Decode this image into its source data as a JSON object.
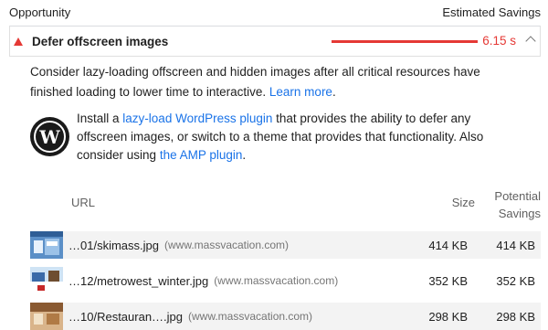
{
  "header": {
    "left": "Opportunity",
    "right": "Estimated Savings"
  },
  "audit": {
    "title": "Defer offscreen images",
    "value": "6.15 s",
    "status_color": "#e53935"
  },
  "description": {
    "text": "Consider lazy-loading offscreen and hidden images after all critical resources have finished loading to lower time to interactive.",
    "link": "Learn more"
  },
  "wordpress": {
    "icon": "wordpress-logo-icon",
    "text_1": "Install a",
    "link_1": "lazy-load WordPress plugin",
    "text_2": "that provides the ability to defer any offscreen images, or switch to a theme that provides that functionality. Also consider using",
    "link_2": "the AMP plugin",
    "text_3": "."
  },
  "table": {
    "columns": {
      "url": "URL",
      "size": "Size",
      "potential_1": "Potential",
      "potential_2": "Savings"
    },
    "rows": [
      {
        "url": "…01/skimass.jpg",
        "host": "(www.massvacation.com)",
        "size": "414 KB",
        "savings": "414 KB"
      },
      {
        "url": "…12/metrowest_winter.jpg",
        "host": "(www.massvacation.com)",
        "size": "352 KB",
        "savings": "352 KB"
      },
      {
        "url": "…10/Restauran….jpg",
        "host": "(www.massvacation.com)",
        "size": "298 KB",
        "savings": "298 KB"
      }
    ]
  }
}
